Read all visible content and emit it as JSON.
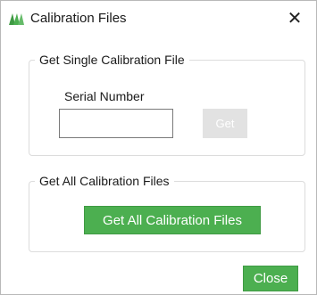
{
  "window": {
    "title": "Calibration Files",
    "app_icon": "brand-logo-icon",
    "close_glyph": "✕",
    "accent_color": "#4caf50"
  },
  "single_group": {
    "legend": "Get Single Calibration File",
    "serial_label": "Serial Number",
    "serial_value": "",
    "get_label": "Get"
  },
  "all_group": {
    "legend": "Get All Calibration Files",
    "button_label": "Get All Calibration Files"
  },
  "footer": {
    "close_label": "Close"
  }
}
